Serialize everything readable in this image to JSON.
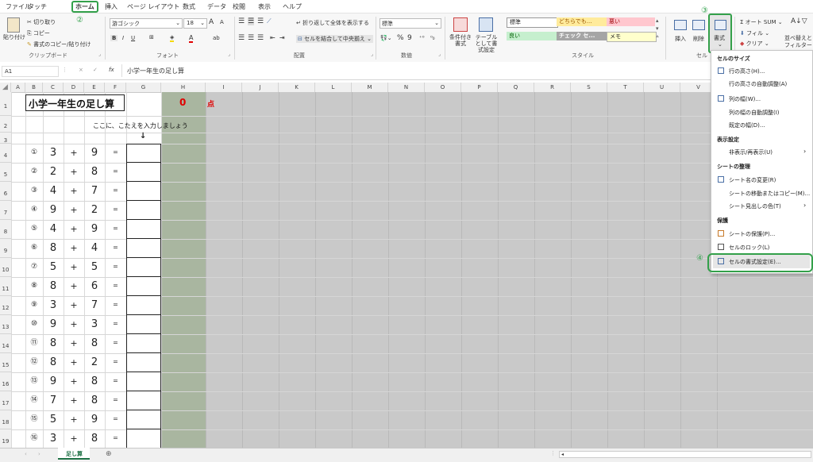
{
  "menu": {
    "tabs": [
      "ファイル",
      "タッチ",
      "ホーム",
      "挿入",
      "ページ レイアウト",
      "数式",
      "データ",
      "校閲",
      "表示",
      "ヘルプ"
    ],
    "step2": "②"
  },
  "ribbon": {
    "clipboard": {
      "paste": "貼り付け",
      "cut": "切り取り",
      "copy": "コピー",
      "format_painter": "書式のコピー/貼り付け",
      "label": "クリップボード"
    },
    "font": {
      "name": "游ゴシック",
      "size": "18",
      "label": "フォント",
      "bold": "B",
      "italic": "I",
      "underline": "U",
      "grow": "A",
      "shrink": "A",
      "font_color": "A",
      "highlight": "ab"
    },
    "alignment": {
      "wrap": "折り返して全体を表示する",
      "merge": "セルを結合して中央揃え",
      "label": "配置"
    },
    "number": {
      "format": "標準",
      "label": "数値",
      "percent": "%",
      "comma": "9"
    },
    "styles": {
      "cond": "条件付き書式",
      "table": "テーブルとして書式設定",
      "cells": [
        "標準",
        "どちらでも...",
        "悪い",
        "良い",
        "チェック セ...",
        "メモ"
      ],
      "label": "スタイル"
    },
    "cells": {
      "insert": "挿入",
      "delete": "削除",
      "format": "書式",
      "label": "セル",
      "step3": "③"
    },
    "editing": {
      "autosum": "オート SUM",
      "fill": "フィル",
      "clear": "クリア",
      "sort": "並べ替えと",
      "filter": "フィルター"
    }
  },
  "formula": {
    "name_box": "A1",
    "fx": "fx",
    "content": "小学一年生の足し算",
    "cancel": "×",
    "enter": "✓"
  },
  "columns": [
    "A",
    "B",
    "C",
    "D",
    "E",
    "F",
    "G",
    "H",
    "I",
    "J",
    "K",
    "L",
    "M",
    "N",
    "O",
    "P",
    "Q",
    "R",
    "S",
    "T",
    "U",
    "V"
  ],
  "sheet": {
    "title": "小学一年生の足し算",
    "score": "0",
    "score_unit": "点",
    "instruction": "ここに、こたえを入力しましょう",
    "arrow": "↓",
    "problems": [
      {
        "num": "①",
        "a": "3",
        "op": "+",
        "b": "9",
        "eq": "="
      },
      {
        "num": "②",
        "a": "2",
        "op": "+",
        "b": "8",
        "eq": "="
      },
      {
        "num": "③",
        "a": "4",
        "op": "+",
        "b": "7",
        "eq": "="
      },
      {
        "num": "④",
        "a": "9",
        "op": "+",
        "b": "2",
        "eq": "="
      },
      {
        "num": "⑤",
        "a": "4",
        "op": "+",
        "b": "9",
        "eq": "="
      },
      {
        "num": "⑥",
        "a": "8",
        "op": "+",
        "b": "4",
        "eq": "="
      },
      {
        "num": "⑦",
        "a": "5",
        "op": "+",
        "b": "5",
        "eq": "="
      },
      {
        "num": "⑧",
        "a": "8",
        "op": "+",
        "b": "6",
        "eq": "="
      },
      {
        "num": "⑨",
        "a": "3",
        "op": "+",
        "b": "7",
        "eq": "="
      },
      {
        "num": "⑩",
        "a": "9",
        "op": "+",
        "b": "3",
        "eq": "="
      },
      {
        "num": "⑪",
        "a": "8",
        "op": "+",
        "b": "8",
        "eq": "="
      },
      {
        "num": "⑫",
        "a": "8",
        "op": "+",
        "b": "2",
        "eq": "="
      },
      {
        "num": "⑬",
        "a": "9",
        "op": "+",
        "b": "8",
        "eq": "="
      },
      {
        "num": "⑭",
        "a": "7",
        "op": "+",
        "b": "8",
        "eq": "="
      },
      {
        "num": "⑮",
        "a": "5",
        "op": "+",
        "b": "9",
        "eq": "="
      },
      {
        "num": "⑯",
        "a": "3",
        "op": "+",
        "b": "8",
        "eq": "="
      }
    ]
  },
  "dropdown": {
    "h_size": "セルのサイズ",
    "row_height": "行の高さ(H)...",
    "row_autofit": "行の高さの自動調整(A)",
    "col_width": "列の幅(W)...",
    "col_autofit": "列の幅の自動調整(I)",
    "default_width": "既定の幅(D)...",
    "h_visibility": "表示設定",
    "hide_unhide": "非表示/再表示(U)",
    "h_organize": "シートの整理",
    "rename": "シート名の変更(R)",
    "move_copy": "シートの移動またはコピー(M)...",
    "tab_color": "シート見出しの色(T)",
    "h_protect": "保護",
    "protect_sheet": "シートの保護(P)...",
    "lock_cell": "セルのロック(L)",
    "format_cells": "セルの書式設定(E)...",
    "step4": "④"
  },
  "tabbar": {
    "sheet_tab": "足し算",
    "add": "⊕"
  },
  "colors": {
    "accent": "#33a04a",
    "score_red": "#e00000",
    "answer_green": "#a9b6a0",
    "sheet_gray": "#c9c9c9"
  }
}
